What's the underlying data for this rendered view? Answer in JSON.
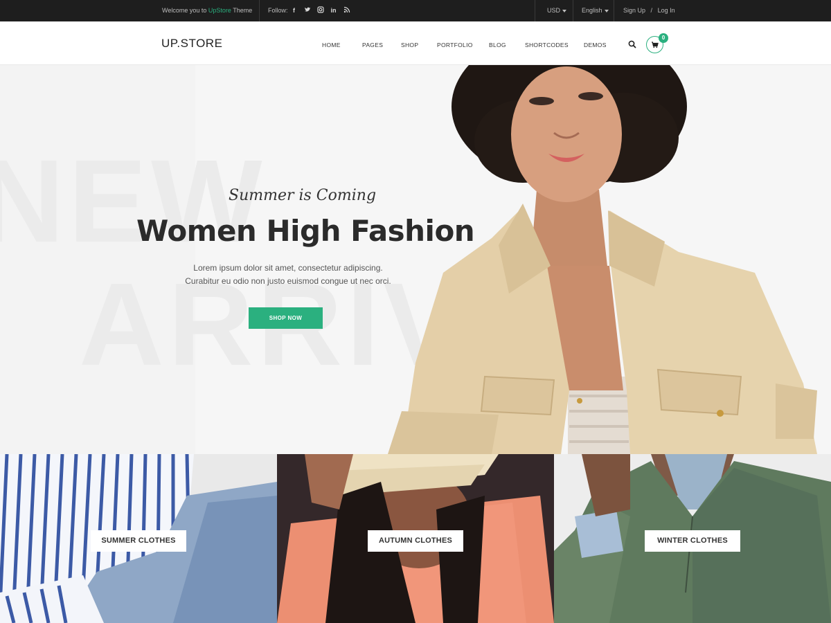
{
  "topbar": {
    "welcome_prefix": "Welcome you to",
    "welcome_brand": "UpStore",
    "welcome_suffix": "Theme",
    "follow_label": "Follow:",
    "socials": [
      "facebook-icon",
      "twitter-icon",
      "instagram-icon",
      "linkedin-icon",
      "rss-icon"
    ],
    "currency": "USD",
    "language": "English",
    "sign_up": "Sign Up",
    "separator": "/",
    "log_in": "Log In"
  },
  "header": {
    "logo": "UP.STORE",
    "nav": [
      "HOME",
      "PAGES",
      "SHOP",
      "PORTFOLIO",
      "BLOG",
      "SHORTCODES",
      "DEMOS"
    ],
    "cart_count": "0"
  },
  "hero": {
    "bg_word_1": "NEW",
    "bg_word_2": "ARRIVAL",
    "subtitle": "Summer is Coming",
    "title": "Women High Fashion",
    "lead_line_1": "Lorem ipsum dolor sit amet, consectetur adipiscing.",
    "lead_line_2": "Curabitur eu odio non justo euismod congue ut nec orci.",
    "cta": "SHOP NOW"
  },
  "categories": [
    {
      "label": "SUMMER CLOTHES"
    },
    {
      "label": "AUTUMN CLOTHES"
    },
    {
      "label": "WINTER CLOTHES"
    }
  ],
  "colors": {
    "accent": "#2bb07f",
    "topbar_bg": "#1e1e1e"
  }
}
